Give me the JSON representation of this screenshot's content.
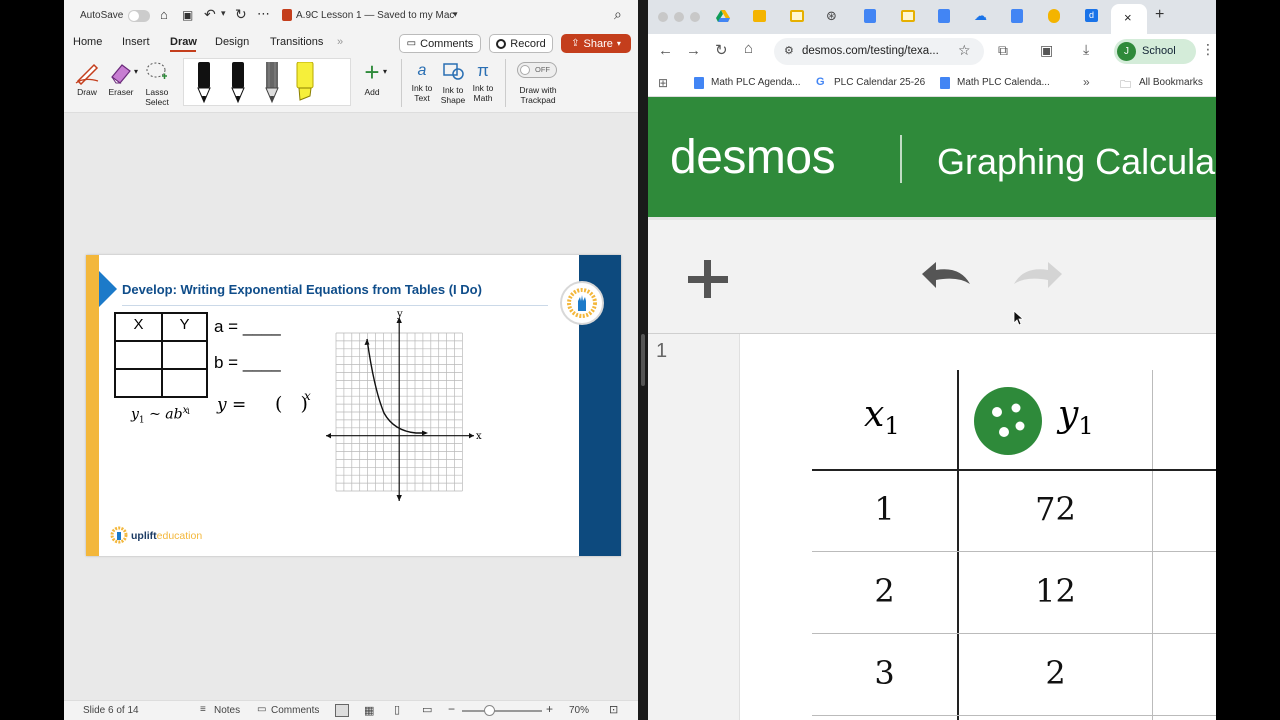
{
  "ppt": {
    "autosave_label": "AutoSave",
    "doc_title": "A.9C Lesson 1 — Saved to my Mac",
    "tabs": [
      "Home",
      "Insert",
      "Draw",
      "Design",
      "Transitions"
    ],
    "active_tab": "Draw",
    "comments_label": "Comments",
    "record_label": "Record",
    "share_label": "Share",
    "ribbon": {
      "draw": "Draw",
      "eraser": "Eraser",
      "lasso_1": "Lasso",
      "lasso_2": "Select",
      "add": "Add",
      "ink_text_1": "Ink to",
      "ink_text_2": "Text",
      "ink_shape_1": "Ink to",
      "ink_shape_2": "Shape",
      "ink_math_1": "Ink to",
      "ink_math_2": "Math",
      "toggle_state": "OFF",
      "trackpad_1": "Draw with",
      "trackpad_2": "Trackpad"
    },
    "pen_colors": [
      "#111111",
      "#111111",
      "#555555",
      "#f6ef3a"
    ],
    "slide": {
      "title": "Develop: Writing Exponential Equations from Tables (I Do)",
      "table_headers": [
        "X",
        "Y"
      ],
      "a_label": "a = ____",
      "b_label": "b = ____",
      "eq_y": "y =",
      "eq_paren": "(   )",
      "eq_x": "x",
      "reg_y1": "y",
      "reg_sub1": "1",
      "reg_tilde": "~",
      "reg_ab": "ab",
      "reg_x": "x",
      "reg_sub2": "1",
      "axis_x": "x",
      "axis_y": "y",
      "logo_text_1": "uplift",
      "logo_text_2": "education",
      "accent_yellow": "#f3b73b",
      "accent_blue": "#0d4a7e",
      "title_color": "#0f4d8a"
    },
    "status": {
      "slide_info": "Slide 6 of 14",
      "notes": "Notes",
      "comments": "Comments",
      "zoom": "70%"
    }
  },
  "chrome": {
    "url": "desmos.com/testing/texa...",
    "profile_label": "School",
    "profile_initial": "J",
    "bookmarks": [
      "Math PLC Agenda...",
      "PLC Calendar 25-26",
      "Math PLC Calenda..."
    ],
    "all_bookmarks": "All Bookmarks"
  },
  "desmos": {
    "brand": "desmos",
    "product": "Graphing Calcula",
    "header_color": "#2f8a3a",
    "expression_number": "1",
    "table": {
      "col1": "x",
      "col1_sub": "1",
      "col2": "y",
      "col2_sub": "1",
      "rows": [
        {
          "x": "1",
          "y": "72"
        },
        {
          "x": "2",
          "y": "12"
        },
        {
          "x": "3",
          "y": "2"
        }
      ]
    }
  }
}
